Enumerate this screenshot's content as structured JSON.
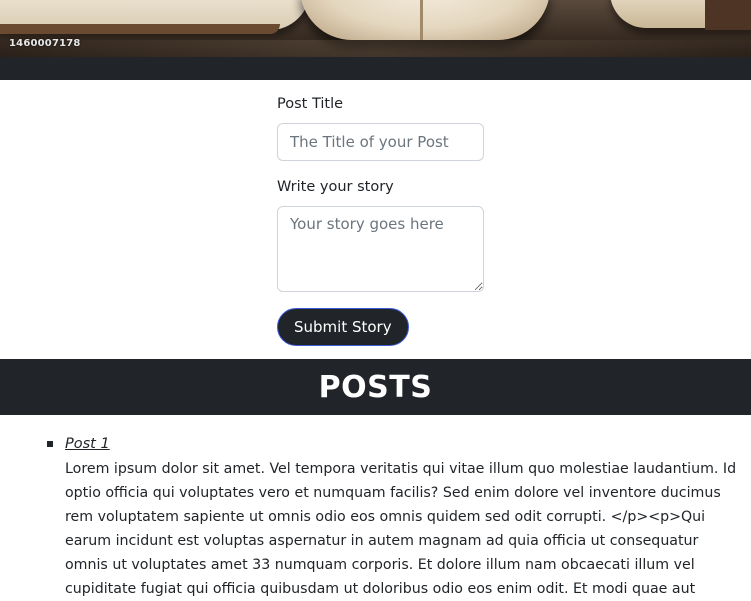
{
  "hero": {
    "stock_id": "1460007178"
  },
  "form": {
    "title_label": "Post Title",
    "title_placeholder": "The Title of your Post",
    "title_value": "",
    "story_label": "Write your story",
    "story_placeholder": "Your story goes here",
    "story_value": "",
    "submit_label": "Submit Story"
  },
  "posts": {
    "header": "POSTS",
    "items": [
      {
        "title": "Post 1",
        "body": "Lorem ipsum dolor sit amet. Vel tempora veritatis qui vitae illum quo molestiae laudantium. Id optio officia qui voluptates vero et numquam facilis? Sed enim dolore vel inventore ducimus rem voluptatem sapiente ut omnis odio eos omnis quidem sed odit corrupti. </p><p>Qui earum incidunt est voluptas aspernatur in autem magnam ad quia officia ut consequatur omnis ut voluptates amet 33 numquam corporis. Et dolore illum nam obcaecati illum vel cupiditate fugiat qui officia quibusdam ut doloribus odio eos enim odit. Et modi quae aut"
      }
    ]
  },
  "colors": {
    "dark": "#212529",
    "button_border": "#3b5bdb",
    "input_border": "#ced4da",
    "placeholder": "#6c757d"
  }
}
